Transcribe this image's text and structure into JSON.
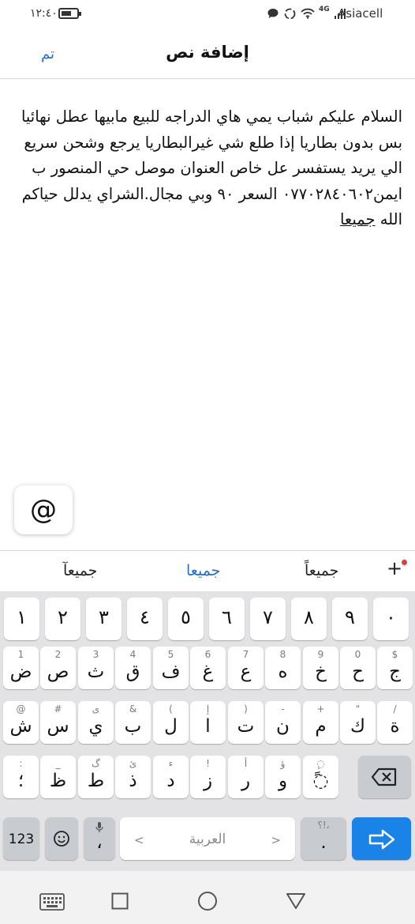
{
  "status_bar": {
    "time": "١٢:٤٠",
    "carrier": "Asiacell",
    "network": "4G"
  },
  "header": {
    "title": "إضافة نص",
    "done_label": "تم"
  },
  "post": {
    "lines": [
      "السلام عليكم شباب يمي هاي الدراجه للبيع مابيها عطل نهائيا",
      "بس بدون بطاريا إذا طلع شي غيرالبطاريا يرجع وشحن سريع",
      "الي يريد يستفسر عل خاص العنوان موصل حي المنصور ب",
      "ايمن٠٧٧٠٢٨٤٠٦٠٢ السعر ٩٠ وبي مجال.الشراي يدلل حياكم"
    ],
    "last_prefix": "الله ",
    "last_underlined": "جميعا"
  },
  "at_button": {
    "label": "@"
  },
  "suggestions": {
    "left": "جميعآ",
    "middle": "جميعا",
    "right": "جميعاً",
    "plus": "+"
  },
  "keyboard": {
    "number_row": [
      "١",
      "٢",
      "٣",
      "٤",
      "٥",
      "٦",
      "٧",
      "٨",
      "٩",
      "٠"
    ],
    "row1": [
      {
        "main": "ض",
        "sub": "1"
      },
      {
        "main": "ص",
        "sub": "2"
      },
      {
        "main": "ث",
        "sub": "3"
      },
      {
        "main": "ق",
        "sub": "4"
      },
      {
        "main": "ف",
        "sub": "5"
      },
      {
        "main": "غ",
        "sub": "6"
      },
      {
        "main": "ع",
        "sub": "7"
      },
      {
        "main": "ه",
        "sub": "8"
      },
      {
        "main": "خ",
        "sub": "9"
      },
      {
        "main": "ح",
        "sub": "0"
      },
      {
        "main": "ج",
        "sub": "$"
      }
    ],
    "row2": [
      {
        "main": "ش",
        "sub": "@"
      },
      {
        "main": "س",
        "sub": "#"
      },
      {
        "main": "ي",
        "sub": "ى"
      },
      {
        "main": "ب",
        "sub": "&"
      },
      {
        "main": "ل",
        "sub": "("
      },
      {
        "main": "ا",
        "sub": "إ"
      },
      {
        "main": "ت",
        "sub": ")"
      },
      {
        "main": "ن",
        "sub": "-"
      },
      {
        "main": "م",
        "sub": "+"
      },
      {
        "main": "ك",
        "sub": "\""
      },
      {
        "main": "ة",
        "sub": "/"
      }
    ],
    "row3": [
      {
        "main": "؛",
        "sub": ":"
      },
      {
        "main": "ظ",
        "sub": "_"
      },
      {
        "main": "ط",
        "sub": "گ"
      },
      {
        "main": "ذ",
        "sub": "ئ"
      },
      {
        "main": "د",
        "sub": "ء"
      },
      {
        "main": "ز",
        "sub": "!"
      },
      {
        "main": "ر",
        "sub": "أ"
      },
      {
        "main": "و",
        "sub": "ؤ"
      },
      {
        "main": "◌ً",
        "sub": "◌ٕ"
      }
    ],
    "bottom": {
      "numbers_label": "123",
      "comma": "،",
      "space_label": "العربية",
      "space_left_arrow": "<",
      "space_right_arrow": ">",
      "period": ".",
      "period_sub": "؟!،"
    }
  },
  "colors": {
    "accent": "#1f6fd0",
    "enter_key": "#1a83e8",
    "keyboard_bg": "#e3e3e5",
    "notification_dot": "#e23b3b"
  }
}
